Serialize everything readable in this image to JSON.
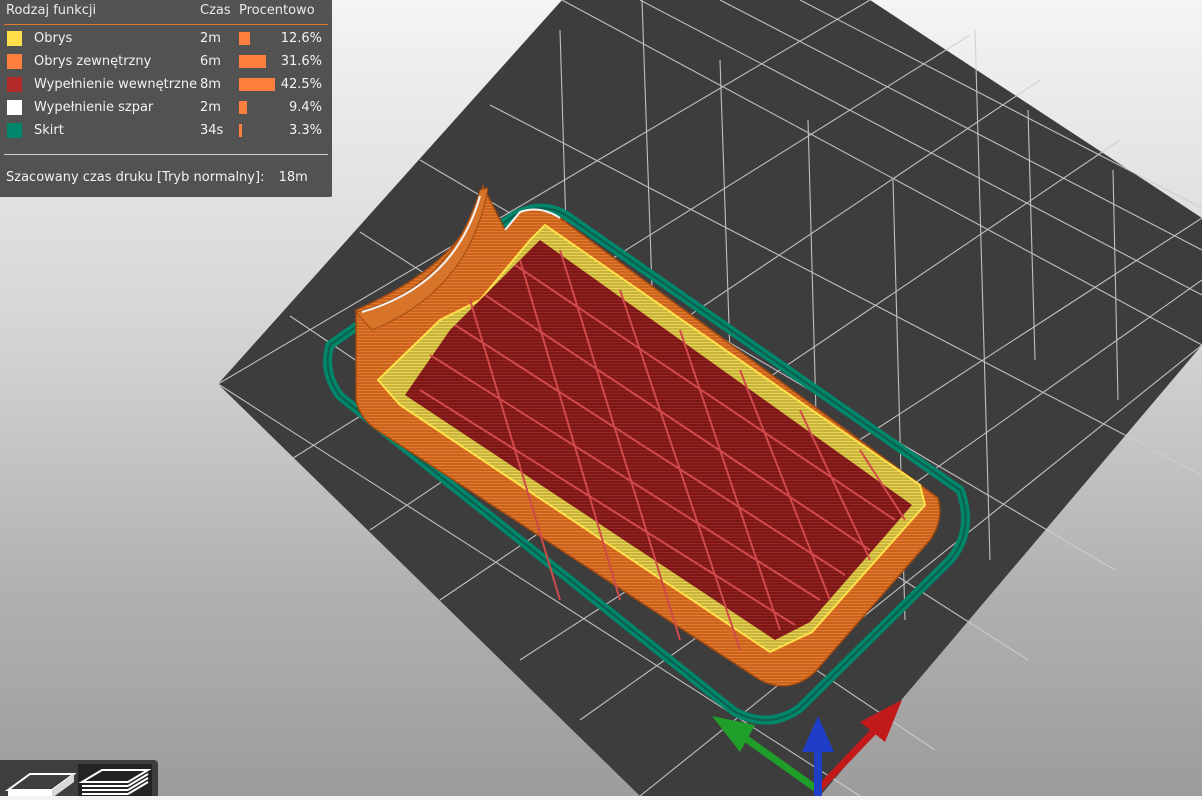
{
  "legend": {
    "headers": {
      "type": "Rodzaj funkcji",
      "time": "Czas",
      "percent": "Procentowo"
    },
    "rows": [
      {
        "name": "Obrys",
        "time": "2m",
        "percent": "12.6%",
        "fraction": 0.126,
        "color": "#ffe04a"
      },
      {
        "name": "Obrys zewnętrzny",
        "time": "6m",
        "percent": "31.6%",
        "fraction": 0.316,
        "color": "#ff7f3f"
      },
      {
        "name": "Wypełnienie wewnętrzne",
        "time": "8m",
        "percent": "42.5%",
        "fraction": 0.425,
        "color": "#b22a2a"
      },
      {
        "name": "Wypełnienie szpar",
        "time": "2m",
        "percent": "9.4%",
        "fraction": 0.094,
        "color": "#ffffff"
      },
      {
        "name": "Skirt",
        "time": "34s",
        "percent": "3.3%",
        "fraction": 0.033,
        "color": "#00876b"
      }
    ],
    "bar_color": "#ff7f3f",
    "estimate_label": "Szacowany czas druku [Tryb normalny]:",
    "estimate_value": "18m"
  },
  "viewport": {
    "bed_color": "#3d3d3d",
    "grid_color": "#cfcfcf",
    "axes": [
      "x-axis-red",
      "y-axis-green",
      "z-axis-blue"
    ]
  },
  "view_buttons": [
    {
      "name": "3d-view",
      "active": false
    },
    {
      "name": "layers-view",
      "active": true
    }
  ]
}
